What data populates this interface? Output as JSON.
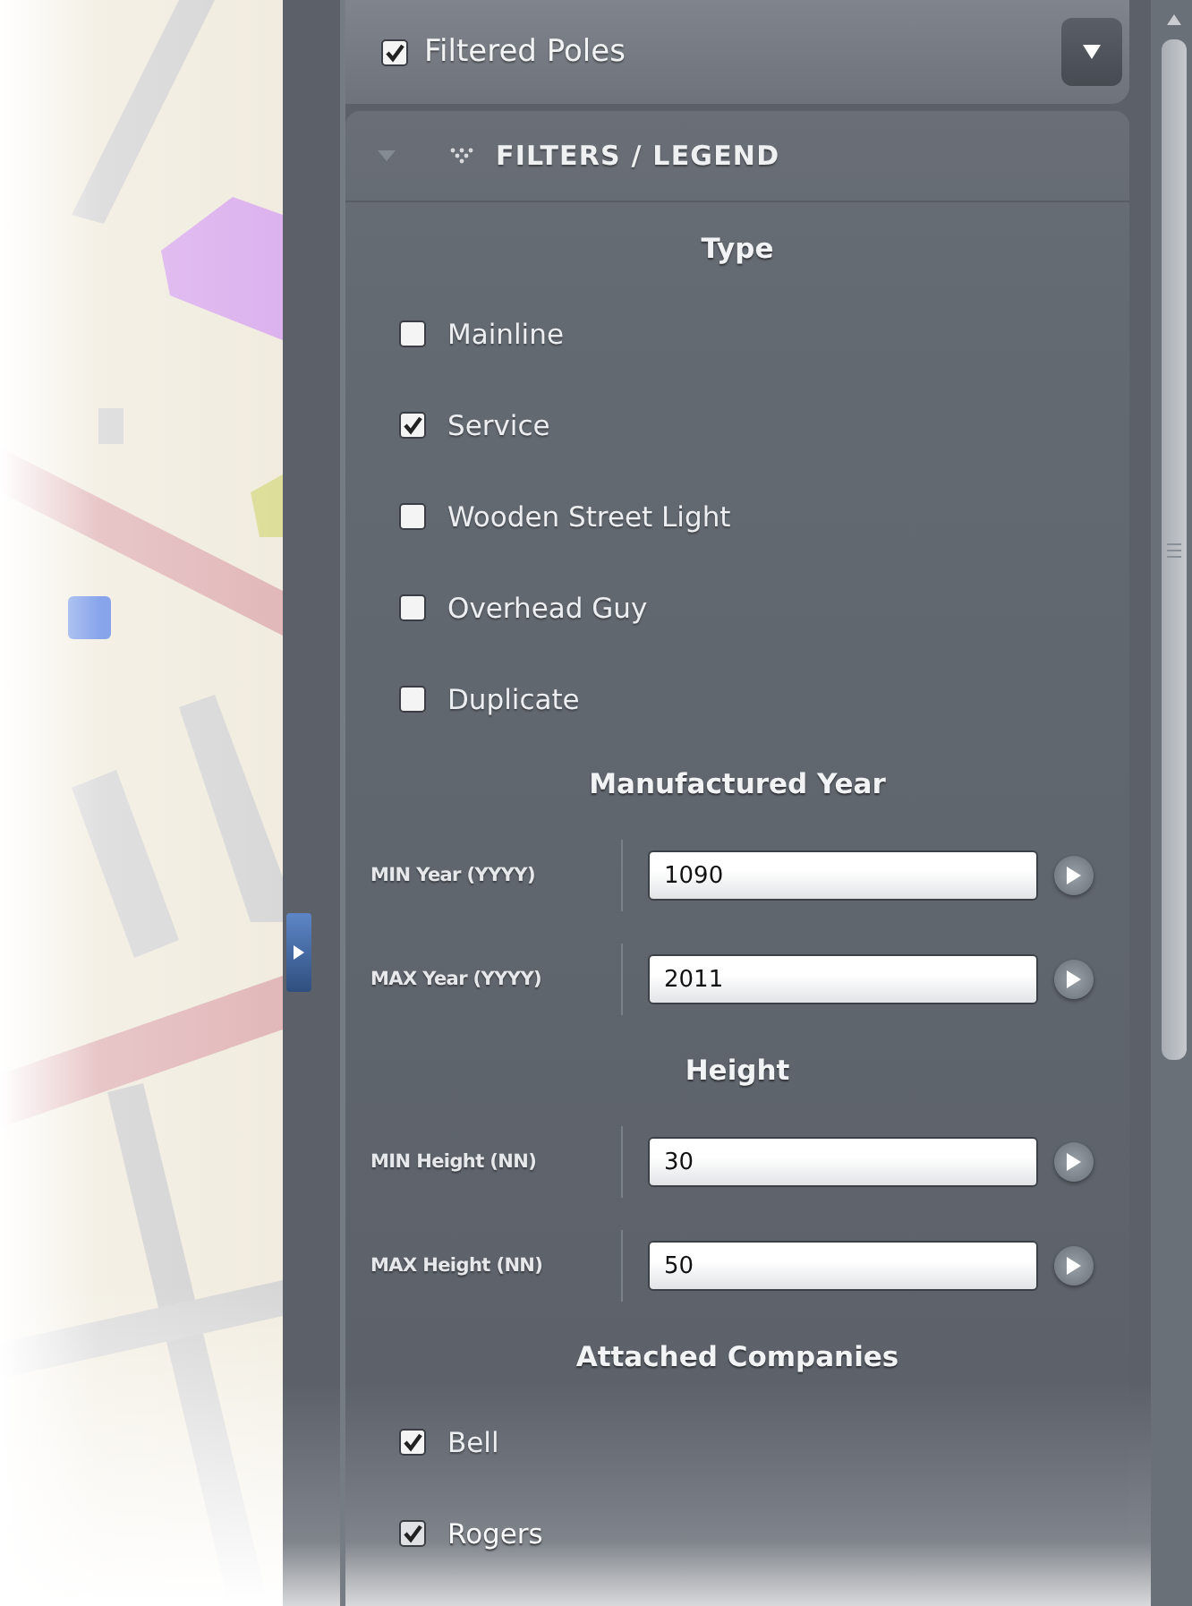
{
  "layer": {
    "label": "Filtered Poles",
    "checked": true
  },
  "section": {
    "title": "FILTERS / LEGEND",
    "expanded": true
  },
  "groups": [
    {
      "kind": "checks",
      "title": "Type",
      "items": [
        {
          "label": "Mainline",
          "checked": false
        },
        {
          "label": "Service",
          "checked": true
        },
        {
          "label": "Wooden Street Light",
          "checked": false
        },
        {
          "label": "Overhead Guy",
          "checked": false
        },
        {
          "label": "Duplicate",
          "checked": false
        }
      ]
    },
    {
      "kind": "range",
      "title": "Manufactured Year",
      "fields": [
        {
          "label": "MIN Year (YYYY)",
          "value": "1090"
        },
        {
          "label": "MAX Year (YYYY)",
          "value": "2011"
        }
      ]
    },
    {
      "kind": "range",
      "title": "Height",
      "fields": [
        {
          "label": "MIN Height (NN)",
          "value": "30"
        },
        {
          "label": "MAX Height (NN)",
          "value": "50"
        }
      ]
    },
    {
      "kind": "checks",
      "title": "Attached Companies",
      "items": [
        {
          "label": "Bell",
          "checked": true
        },
        {
          "label": "Rogers",
          "checked": true
        }
      ]
    }
  ]
}
